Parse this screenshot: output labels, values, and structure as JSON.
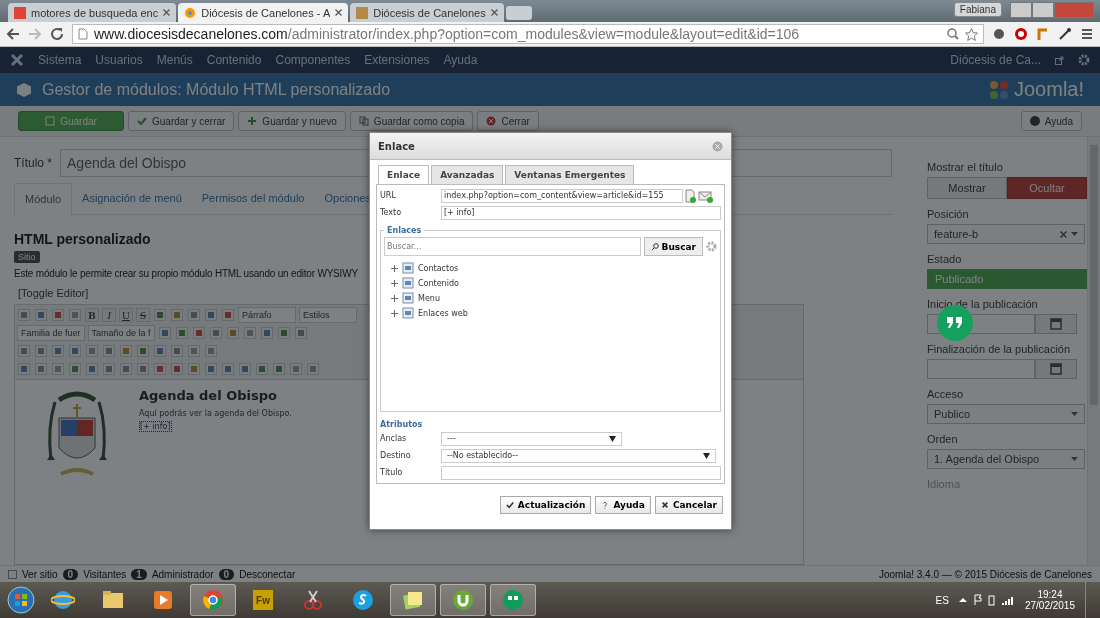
{
  "browser": {
    "tabs": [
      {
        "title": "motores de busqueda enc",
        "selected": false
      },
      {
        "title": "Diócesis de Canelones - A",
        "selected": true
      },
      {
        "title": "Diócesis de Canelones",
        "selected": false
      }
    ],
    "user": "Fabiana",
    "address_host": "www.diocesisdecanelones.com",
    "address_path": "/administrator/index.php?option=com_modules&view=module&layout=edit&id=106"
  },
  "nav": {
    "items": [
      "Sistema",
      "Usuarios",
      "Menús",
      "Contenido",
      "Componentes",
      "Extensiones",
      "Ayuda"
    ],
    "site": "Diócesis de Ca..."
  },
  "header": {
    "title": "Gestor de módulos: Módulo HTML personalizado",
    "logo": "Joomla!"
  },
  "toolbar": {
    "buttons": [
      {
        "label": "Guardar",
        "kind": "primary"
      },
      {
        "label": "Guardar y cerrar",
        "kind": "default"
      },
      {
        "label": "Guardar y nuevo",
        "kind": "default"
      },
      {
        "label": "Guardar como copia",
        "kind": "default"
      },
      {
        "label": "Cerrar",
        "kind": "default"
      }
    ],
    "help": "Ayuda"
  },
  "title_field": {
    "label": "Título *",
    "value": "Agenda del Obispo"
  },
  "module_tabs": [
    {
      "label": "Módulo",
      "selected": true
    },
    {
      "label": "Asignación de menú",
      "selected": false
    },
    {
      "label": "Permisos del módulo",
      "selected": false
    },
    {
      "label": "Opciones",
      "selected": false
    }
  ],
  "module": {
    "heading": "HTML personalizado",
    "badge": "Sitio",
    "description": "Este módulo le permite crear su propio módulo HTML usando un editor WYSIWY",
    "toggle": "[Toggle Editor]"
  },
  "editor": {
    "format_buttons": [
      "B",
      "I",
      "U",
      "S"
    ],
    "paragraph": "Párrafo",
    "styles": "Estilos",
    "font_family": "Familia de fuer",
    "font_size": "Tamaño de la f",
    "content": {
      "heading": "Agenda del Obispo",
      "text": "Aquí podrás ver la agenda del Obispo.",
      "link": "[+ info]"
    }
  },
  "options": {
    "show_title": {
      "label": "Mostrar el título",
      "choices": [
        {
          "label": "Mostrar",
          "selected": false
        },
        {
          "label": "Ocultar",
          "selected": true
        }
      ]
    },
    "fields": [
      {
        "kind": "select",
        "label": "Posición",
        "value": "feature-b",
        "clearable": true
      },
      {
        "kind": "status",
        "label": "Estado",
        "value": "Publicado"
      },
      {
        "kind": "date",
        "label": "Inicio de la publicación"
      },
      {
        "kind": "date",
        "label": "Finalización de la publicación"
      },
      {
        "kind": "select",
        "label": "Acceso",
        "value": "Publico",
        "clearable": false
      },
      {
        "kind": "select",
        "label": "Orden",
        "value": "1. Agenda del Obispo",
        "clearable": false
      },
      {
        "kind": "label",
        "label": "Idioma"
      }
    ]
  },
  "status_bar": {
    "items": [
      {
        "label": "Ver sitio"
      },
      {
        "count": "0",
        "label": "Visitantes"
      },
      {
        "count": "1",
        "label": "Administrador"
      },
      {
        "count": "0",
        "label": "Desconectar"
      }
    ],
    "footer": "Joomla! 3.4.0 — © 2015 Diócesis de Canelones"
  },
  "dialog": {
    "title": "Enlace",
    "tabs": [
      {
        "label": "Enlace",
        "selected": true
      },
      {
        "label": "Avanzadas",
        "selected": false
      },
      {
        "label": "Ventanas Emergentes",
        "selected": false
      }
    ],
    "url_label": "URL",
    "url": "index.php?option=com_content&view=article&id=155",
    "text_label": "Texto",
    "text": "[+ info]",
    "links_legend": "Enlaces",
    "search_placeholder": "Buscar...",
    "search_button": "Buscar",
    "tree": [
      {
        "label": "Contactos",
        "expanded": false
      },
      {
        "label": "Contenido",
        "expanded": false
      },
      {
        "label": "Menu",
        "expanded": false
      },
      {
        "label": "Enlaces web",
        "expanded": false
      }
    ],
    "attributes_legend": "Atributos",
    "anchors_label": "Anclas",
    "anchors": "---",
    "target_label": "Destino",
    "target": "--No establecido--",
    "title_label": "Título",
    "buttons": [
      {
        "label": "Actualización",
        "kind": "ok"
      },
      {
        "label": "Ayuda",
        "kind": "help"
      },
      {
        "label": "Cancelar",
        "kind": "cancel"
      }
    ]
  },
  "taskbar": {
    "apps": [
      {
        "kind": "ie",
        "running": false
      },
      {
        "kind": "folder",
        "running": false
      },
      {
        "kind": "media",
        "running": false
      },
      {
        "kind": "chrome",
        "running": true
      },
      {
        "kind": "fireworks",
        "label": "Fw",
        "running": false
      },
      {
        "kind": "scissors",
        "running": false
      },
      {
        "kind": "skype",
        "running": false
      },
      {
        "kind": "notes",
        "running": true
      },
      {
        "kind": "torrent",
        "running": true
      },
      {
        "kind": "hangouts",
        "running": true
      }
    ],
    "language": "ES",
    "time": "19:24",
    "date": "27/02/2015"
  }
}
